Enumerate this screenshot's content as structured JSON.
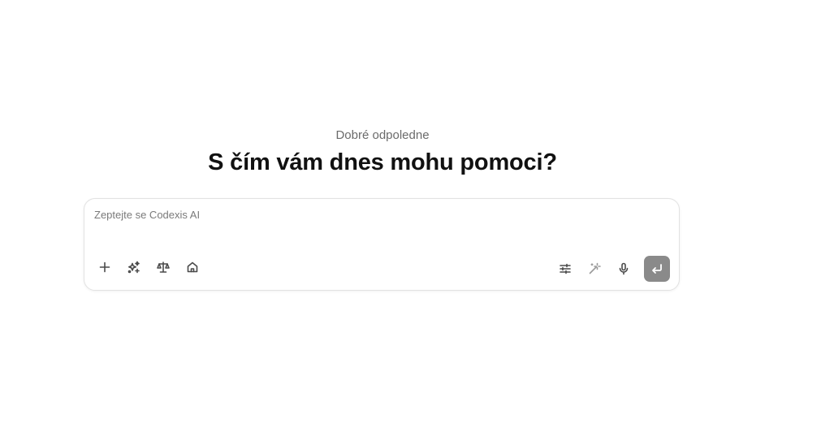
{
  "header": {
    "greeting": "Dobré odpoledne",
    "headline": "S čím vám dnes mohu pomoci?"
  },
  "composer": {
    "placeholder": "Zeptejte se Codexis AI",
    "value": "",
    "left_tools": [
      {
        "icon": "plus-icon"
      },
      {
        "icon": "sparkles-icon"
      },
      {
        "icon": "scales-icon"
      },
      {
        "icon": "home-icon"
      }
    ],
    "right_tools": [
      {
        "icon": "sliders-icon"
      },
      {
        "icon": "magic-wand-icon"
      },
      {
        "icon": "microphone-icon"
      }
    ],
    "send_icon": "enter-icon",
    "send_color": "#8a8a8a"
  }
}
